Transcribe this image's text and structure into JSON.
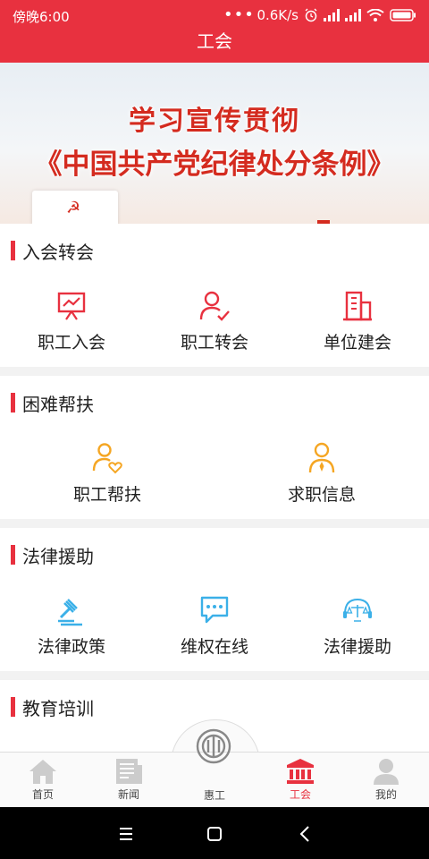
{
  "status": {
    "time": "傍晚6:00",
    "speed": "0.6K/s",
    "dots": "•••",
    "hd": "HD"
  },
  "header": {
    "title": "工会"
  },
  "banner": {
    "line1": "学习宣传贯彻",
    "line2": "《中国共产党纪律处分条例》",
    "accent_color": "#d42b1f"
  },
  "sections": [
    {
      "title": "入会转会",
      "items": [
        {
          "label": "职工入会",
          "icon": "presentation-board-icon",
          "color": "#e8313f"
        },
        {
          "label": "职工转会",
          "icon": "user-check-icon",
          "color": "#e8313f"
        },
        {
          "label": "单位建会",
          "icon": "building-icon",
          "color": "#e8313f"
        }
      ]
    },
    {
      "title": "困难帮扶",
      "items": [
        {
          "label": "职工帮扶",
          "icon": "user-heart-icon",
          "color": "#f5a623"
        },
        {
          "label": "求职信息",
          "icon": "user-tie-icon",
          "color": "#f5a623"
        }
      ]
    },
    {
      "title": "法律援助",
      "items": [
        {
          "label": "法律政策",
          "icon": "gavel-icon",
          "color": "#3bb0e8"
        },
        {
          "label": "维权在线",
          "icon": "chat-bubble-icon",
          "color": "#3bb0e8"
        },
        {
          "label": "法律援助",
          "icon": "scales-headset-icon",
          "color": "#3bb0e8"
        }
      ]
    },
    {
      "title": "教育培训",
      "items": []
    }
  ],
  "tabbar": {
    "tabs": [
      {
        "label": "首页",
        "icon": "home-icon"
      },
      {
        "label": "新闻",
        "icon": "news-icon"
      },
      {
        "label": "惠工",
        "icon": "union-logo-icon"
      },
      {
        "label": "工会",
        "icon": "bank-icon",
        "active": true
      },
      {
        "label": "我的",
        "icon": "person-icon"
      }
    ],
    "active_color": "#e8313f",
    "inactive_color": "#cccccc"
  },
  "colors": {
    "brand": "#e8313f"
  }
}
